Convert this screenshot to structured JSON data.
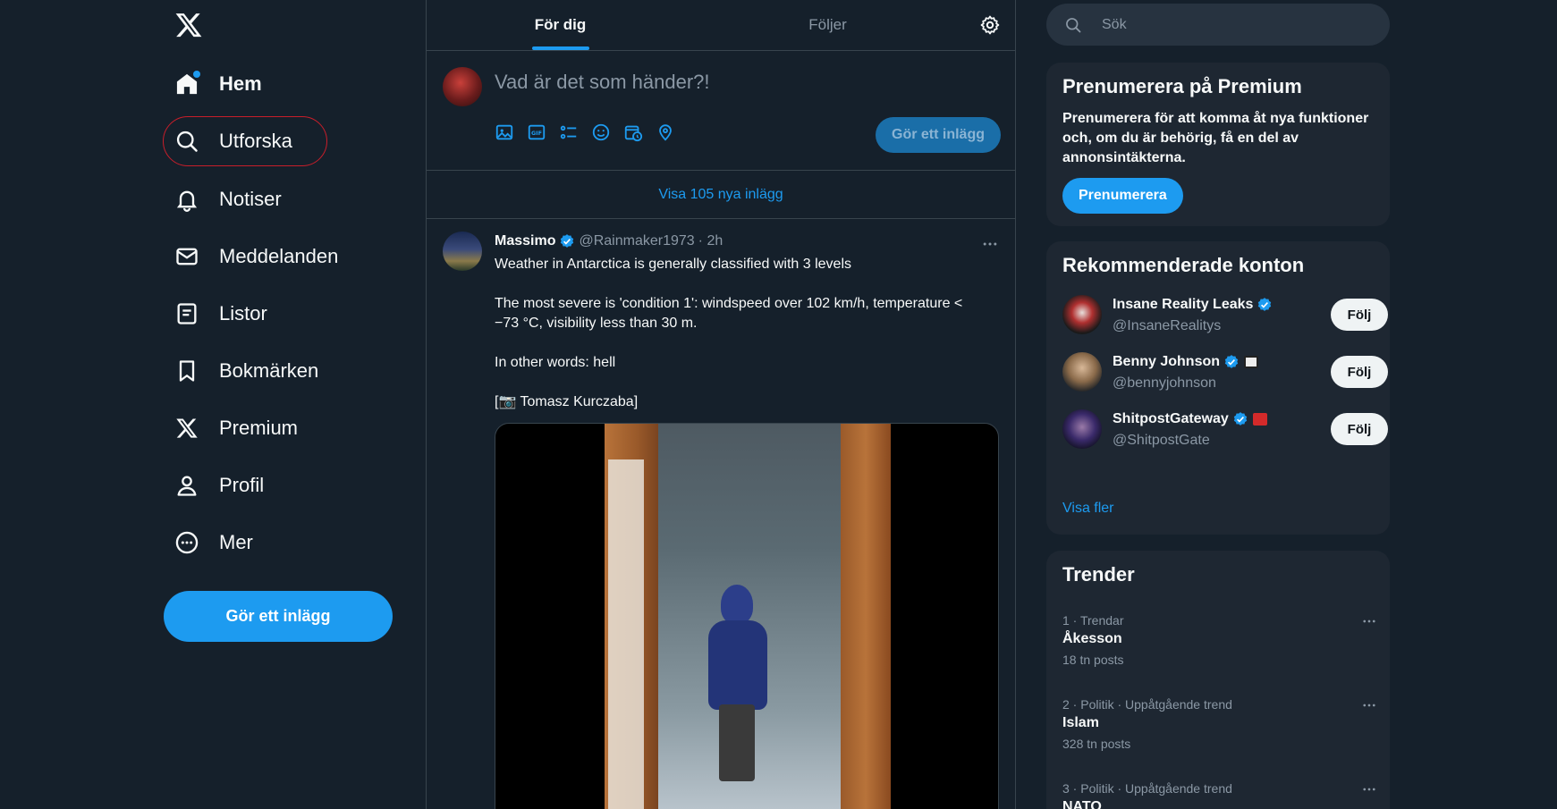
{
  "nav": {
    "items": [
      {
        "label": "Hem",
        "icon": "home-icon"
      },
      {
        "label": "Utforska",
        "icon": "search-icon"
      },
      {
        "label": "Notiser",
        "icon": "bell-icon"
      },
      {
        "label": "Meddelanden",
        "icon": "mail-icon"
      },
      {
        "label": "Listor",
        "icon": "list-icon"
      },
      {
        "label": "Bokmärken",
        "icon": "bookmark-icon"
      },
      {
        "label": "Premium",
        "icon": "x-logo-icon"
      },
      {
        "label": "Profil",
        "icon": "person-icon"
      },
      {
        "label": "Mer",
        "icon": "more-circle-icon"
      }
    ],
    "post_label": "Gör ett inlägg"
  },
  "center": {
    "tabs": [
      {
        "label": "För dig"
      },
      {
        "label": "Följer"
      }
    ],
    "composer": {
      "placeholder": "Vad är det som händer?!",
      "post_label": "Gör ett inlägg"
    },
    "show_new": "Visa 105 nya inlägg",
    "tweet": {
      "name": "Massimo",
      "handle": "@Rainmaker1973",
      "time": "· 2h",
      "paragraphs": [
        "Weather in Antarctica is generally classified with 3 levels",
        "The most severe is 'condition 1': windspeed over 102 km/h, temperature <\n−73 °C, visibility less than 30 m.",
        "In other words: hell",
        "[📷 Tomasz Kurczaba]"
      ]
    }
  },
  "right": {
    "search_placeholder": "Sök",
    "premium": {
      "title": "Prenumerera på Premium",
      "desc": "Prenumerera för att komma åt nya funktioner och, om du är behörig, få en del av annonsintäkterna.",
      "button": "Prenumerera"
    },
    "reco": {
      "title": "Rekommenderade konton",
      "accounts": [
        {
          "name": "Insane Reality Leaks",
          "handle": "@InsaneRealitys",
          "follow": "Följ"
        },
        {
          "name": "Benny Johnson",
          "handle": "@bennyjohnson",
          "follow": "Följ"
        },
        {
          "name": "ShitpostGateway",
          "handle": "@ShitpostGate",
          "follow": "Följ"
        }
      ],
      "more": "Visa fler"
    },
    "trends": {
      "title": "Trender",
      "items": [
        {
          "meta": "1 · Trendar",
          "title": "Åkesson",
          "count": "18 tn posts"
        },
        {
          "meta": "2 · Politik · Uppåtgående trend",
          "title": "Islam",
          "count": "328 tn posts"
        },
        {
          "meta": "3 · Politik · Uppåtgående trend",
          "title": "NATO",
          "count": ""
        }
      ]
    }
  },
  "colors": {
    "background": "#15202b",
    "accent": "#1d9bf0",
    "card": "#1e2732",
    "muted_text": "#8b98a5",
    "border": "#38444d"
  }
}
